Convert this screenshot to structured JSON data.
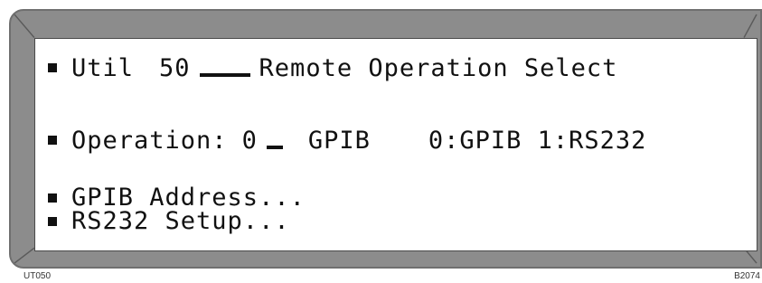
{
  "screen": {
    "menu_line": {
      "name": "Util",
      "code": "50",
      "title": "Remote Operation Select"
    },
    "operation_line": {
      "label": "Operation:",
      "value": "0",
      "value_text": "GPIB",
      "options": "0:GPIB 1:RS232"
    },
    "submenu": [
      {
        "label": "GPIB Address..."
      },
      {
        "label": "RS232 Setup..."
      }
    ]
  },
  "captions": {
    "left": "UT050",
    "right": "B2074"
  },
  "colors": {
    "bezel": "#8c8c8c",
    "screen_bg": "#ffffff",
    "text": "#111111"
  }
}
